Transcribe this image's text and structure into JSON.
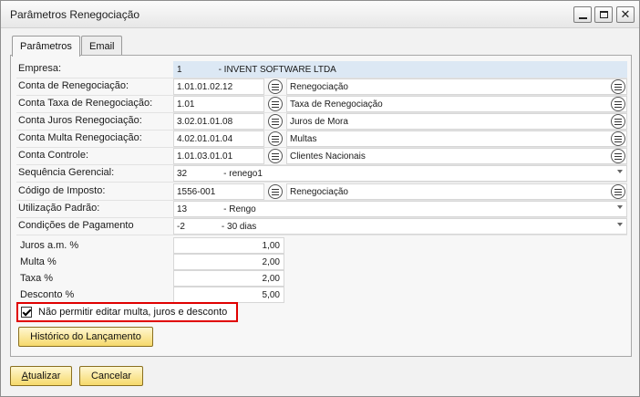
{
  "window": {
    "title": "Parâmetros Renegociação"
  },
  "tabs": [
    {
      "label": "Parâmetros",
      "active": true
    },
    {
      "label": "Email",
      "active": false
    }
  ],
  "form": {
    "empresa": {
      "label": "Empresa:",
      "code": "1",
      "name": "- INVENT SOFTWARE LTDA"
    },
    "accounts": [
      {
        "label": "Conta de Renegociação:",
        "code": "1.01.01.02.12",
        "desc": "Renegociação"
      },
      {
        "label": "Conta Taxa de Renegociação:",
        "code": "1.01",
        "desc": "Taxa de Renegociação"
      },
      {
        "label": "Conta Juros  Renegociação:",
        "code": "3.02.01.01.08",
        "desc": "Juros de Mora"
      },
      {
        "label": "Conta Multa  Renegociação:",
        "code": "4.02.01.01.04",
        "desc": "Multas"
      },
      {
        "label": "Conta Controle:",
        "code": "1.01.03.01.01",
        "desc": "Clientes Nacionais"
      }
    ],
    "sequencia": {
      "label": "Sequência Gerencial:",
      "code": "32",
      "name": "- renego1"
    },
    "imposto": {
      "label": "Código de Imposto:",
      "code": "1556-001",
      "desc": "Renegociação"
    },
    "utilizacao": {
      "label": "Utilização Padrão:",
      "code": "13",
      "name": "- Rengo"
    },
    "condicoes": {
      "label": "Condições de Pagamento",
      "code": "-2",
      "name": "- 30 dias"
    },
    "rates": [
      {
        "label": "Juros  a.m. %",
        "value": "1,00"
      },
      {
        "label": "Multa %",
        "value": "2,00"
      },
      {
        "label": "Taxa %",
        "value": "2,00"
      },
      {
        "label": "Desconto %",
        "value": "5,00"
      }
    ],
    "checkbox": {
      "label": "Não permitir editar multa, juros e desconto",
      "checked": true
    }
  },
  "buttons": {
    "historico": "Histórico do Lançamento",
    "atualizar_first": "A",
    "atualizar_rest": "tualizar",
    "cancelar": "Cancelar"
  },
  "colors": {
    "highlight_border": "#e00000",
    "button_fill": "#f6d96b",
    "empresa_fill": "#dce8f4"
  },
  "icons": {
    "pick": "list-picker-icon",
    "dropdown": "chevron-down-icon"
  }
}
